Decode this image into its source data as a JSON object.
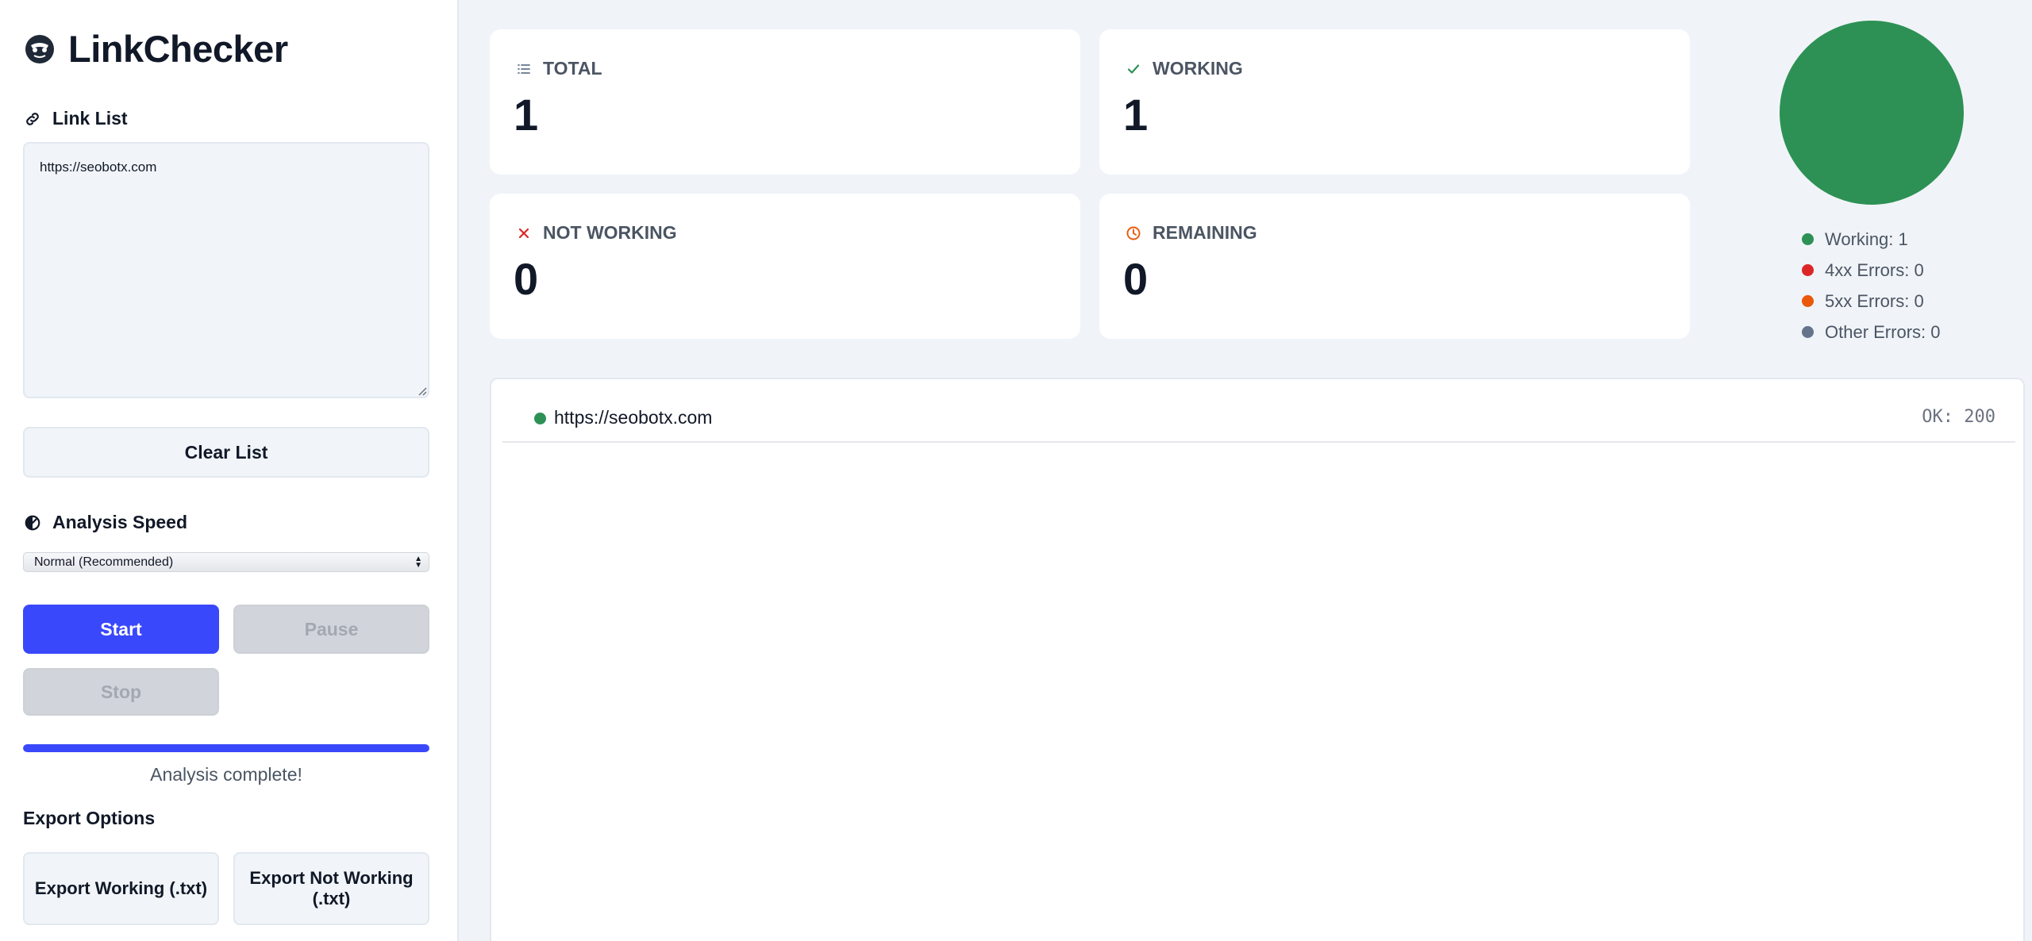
{
  "app": {
    "title": "LinkChecker"
  },
  "sidebar": {
    "link_list_label": "Link List",
    "link_list_value": "https://seobotx.com",
    "clear_button": "Clear List",
    "speed_label": "Analysis Speed",
    "speed_selected": "Normal (Recommended)",
    "start_button": "Start",
    "pause_button": "Pause",
    "stop_button": "Stop",
    "progress_percent": 100,
    "progress_status": "Analysis complete!",
    "export_title": "Export Options",
    "export_working": "Export Working (.txt)",
    "export_not_working": "Export Not Working (.txt)"
  },
  "stats": {
    "total": {
      "label": "TOTAL",
      "value": "1",
      "icon": "list-icon"
    },
    "working": {
      "label": "WORKING",
      "value": "1",
      "icon": "check-icon"
    },
    "not_working": {
      "label": "NOT WORKING",
      "value": "0",
      "icon": "x-icon"
    },
    "remaining": {
      "label": "REMAINING",
      "value": "0",
      "icon": "clock-icon"
    }
  },
  "legend": {
    "working": "Working: 1",
    "errors_4xx": "4xx Errors: 0",
    "errors_5xx": "5xx Errors: 0",
    "other_errors": "Other Errors: 0"
  },
  "chart_data": {
    "type": "pie",
    "categories": [
      "Working",
      "4xx Errors",
      "5xx Errors",
      "Other Errors"
    ],
    "values": [
      1,
      0,
      0,
      0
    ],
    "colors": [
      "#2d9155",
      "#dc2626",
      "#ea580c",
      "#64748b"
    ]
  },
  "results": [
    {
      "url": "https://seobotx.com",
      "status": "OK: 200",
      "color": "#2d9155"
    }
  ],
  "colors": {
    "accent": "#3a48fb",
    "working": "#2d9155",
    "error_4xx": "#dc2626",
    "error_5xx": "#ea580c",
    "other": "#64748b"
  }
}
